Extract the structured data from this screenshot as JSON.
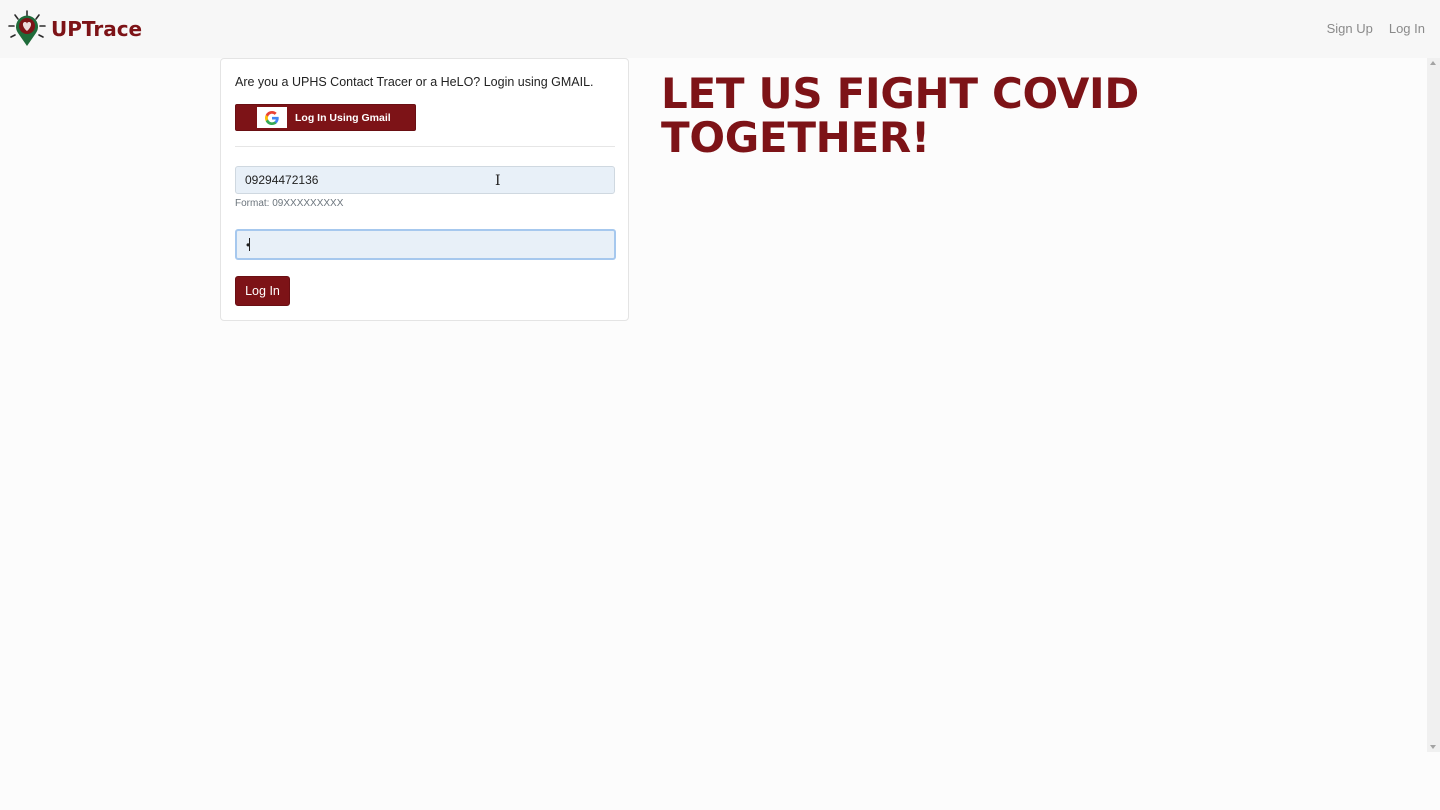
{
  "app": {
    "name": "UPTrace",
    "colors": {
      "brand": "#7d1317",
      "page_bg": "#fcfcfc",
      "input_bg": "#e8f0f8"
    }
  },
  "nav": {
    "items": [
      {
        "label": "Sign Up"
      },
      {
        "label": "Log In"
      }
    ]
  },
  "login_card": {
    "prompt": "Are you a UPHS Contact Tracer or a HeLO? Login using GMAIL.",
    "gmail_button_label": "Log In Using Gmail",
    "google_icon": "google-g-icon",
    "phone_value": "09294472136",
    "phone_format_hint": "Format: 09XXXXXXXXX",
    "password_value": "•",
    "submit_label": "Log In"
  },
  "hero": {
    "line1": "LET US FIGHT COVID",
    "line2": "TOGETHER!"
  }
}
